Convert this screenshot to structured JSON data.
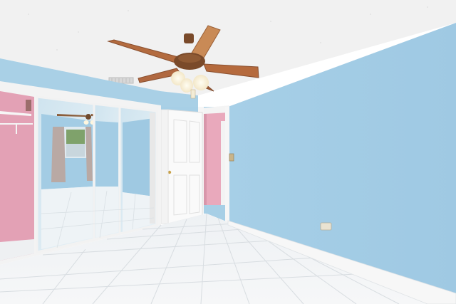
{
  "scene": {
    "type": "photo",
    "subject": "empty-bedroom",
    "visible_text": []
  },
  "palette": {
    "ceiling": "#f2f2f2",
    "wall_blue": "#a9d2ea",
    "wall_blue_shadow": "#9fc8e2",
    "hallway_pink": "#e8a7bb",
    "closet_pink": "#e4a2b6",
    "floor_tile": "#f2f4f6",
    "baseboard": "#f7f7f7",
    "door": "#fafafa",
    "fan_blade": "#b46a3e",
    "fan_body": "#7a4a2a",
    "mirror_glass": "#d7e8f1"
  }
}
